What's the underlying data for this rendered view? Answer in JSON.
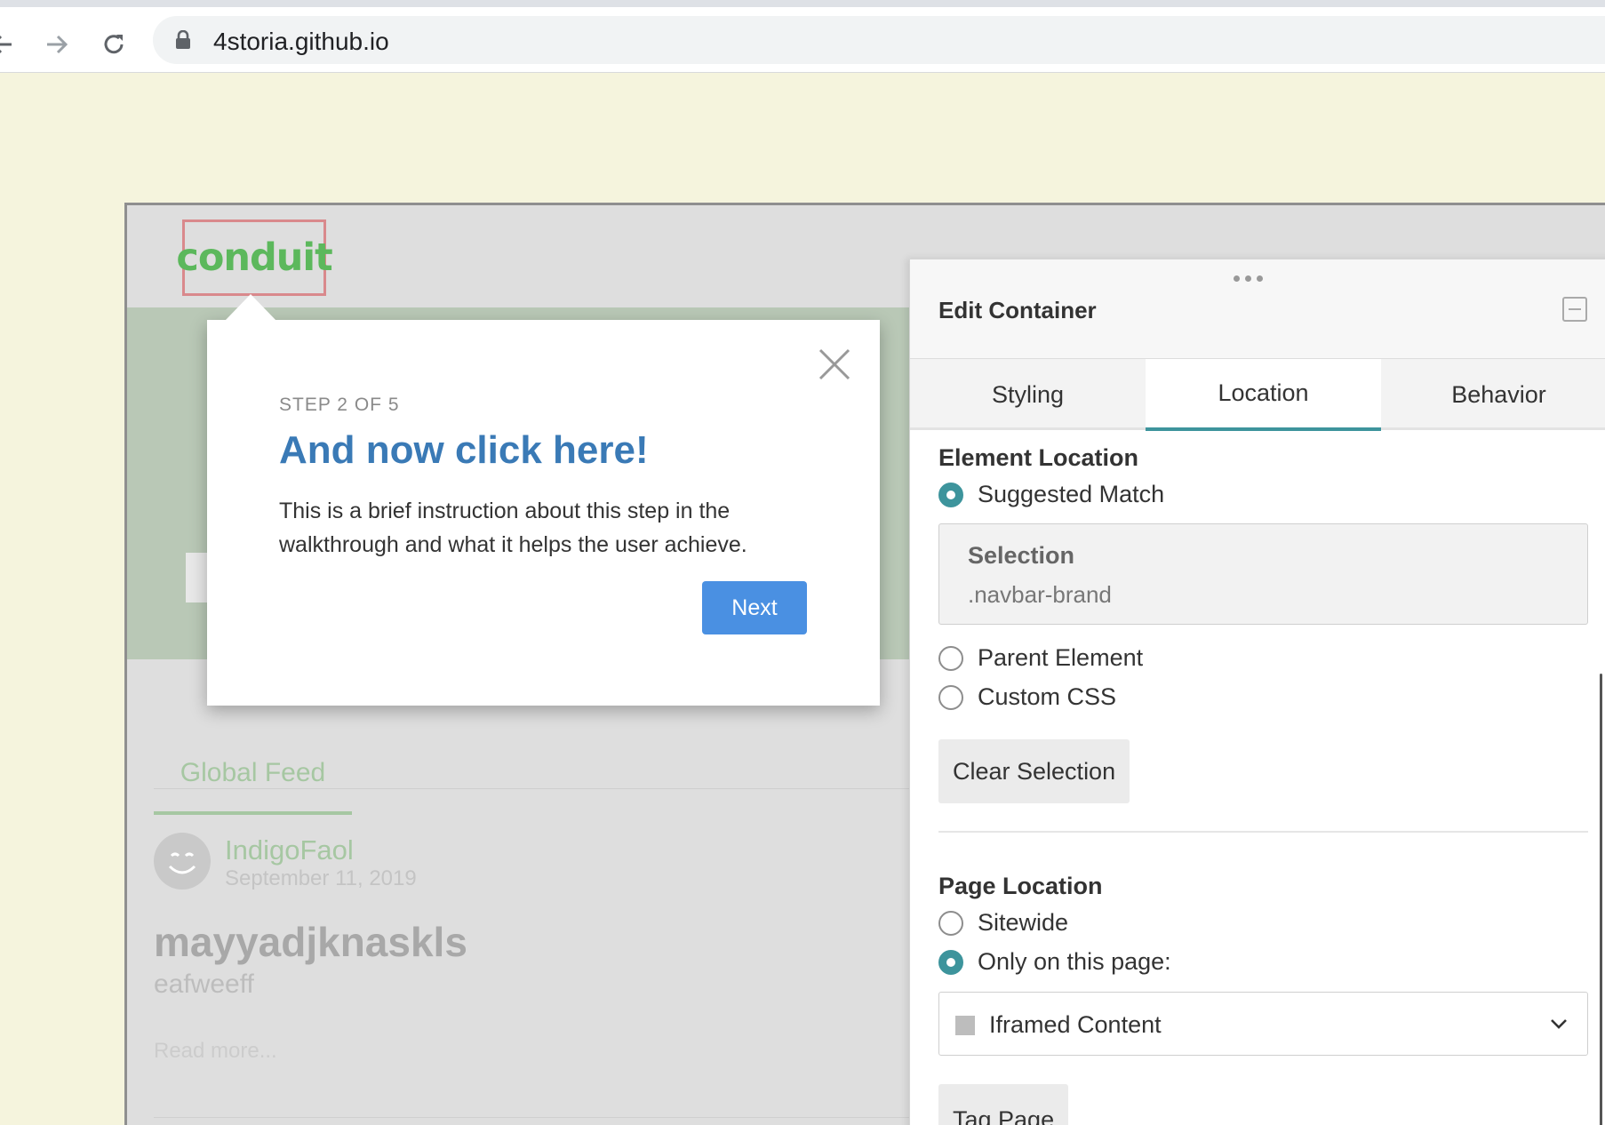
{
  "browser": {
    "url": "4storia.github.io",
    "icons": {
      "back": "arrow-left-icon",
      "forward": "arrow-right-icon",
      "reload": "reload-icon",
      "lock": "lock-icon"
    }
  },
  "site": {
    "brand": "conduit",
    "feed_tab": "Global Feed",
    "article": {
      "author": "IndigoFaol",
      "date": "September 11, 2019",
      "title": "mayyadjknaskls",
      "description": "eafweeff",
      "read_more": "Read more..."
    }
  },
  "walkthrough": {
    "step_label": "STEP 2 OF 5",
    "title": "And now click here!",
    "body": "This is a brief instruction about this step in the walkthrough and what it helps the user achieve.",
    "next_label": "Next",
    "title_color": "#3a7ab6",
    "button_color": "#4a90e2"
  },
  "panel": {
    "title": "Edit Container",
    "tabs": [
      {
        "label": "Styling",
        "active": false
      },
      {
        "label": "Location",
        "active": true
      },
      {
        "label": "Behavior",
        "active": false
      }
    ],
    "element_location": {
      "title": "Element Location",
      "options": [
        {
          "label": "Suggested Match",
          "selected": true
        },
        {
          "label": "Parent Element",
          "selected": false
        },
        {
          "label": "Custom CSS",
          "selected": false
        }
      ],
      "selection_label": "Selection",
      "selection_value": ".navbar-brand",
      "clear_label": "Clear Selection"
    },
    "page_location": {
      "title": "Page Location",
      "options": [
        {
          "label": "Sitewide",
          "selected": false
        },
        {
          "label": "Only on this page:",
          "selected": true
        }
      ],
      "page_select": "Iframed Content",
      "tag_label": "Tag Page"
    },
    "accent_color": "#3d949c"
  }
}
